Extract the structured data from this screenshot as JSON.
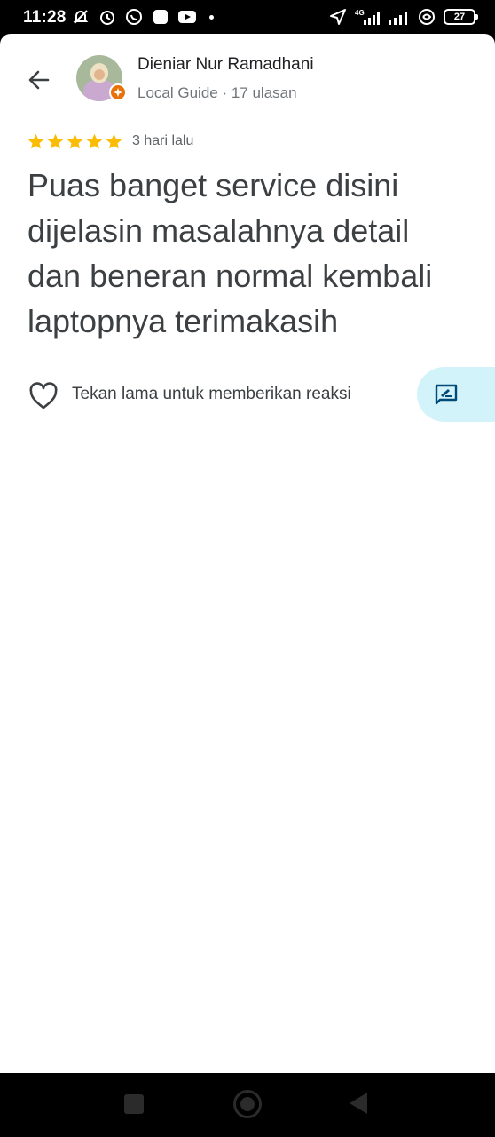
{
  "status_bar": {
    "time": "11:28",
    "left_icons": [
      "mute-icon",
      "alarm-icon",
      "whatsapp-icon",
      "app-icon",
      "youtube-icon",
      "dot-icon"
    ],
    "right_icons": [
      "location-icon",
      "signal-4g-icon",
      "signal-icon",
      "hotspot-icon",
      "battery-icon"
    ],
    "network_label": "4G",
    "battery_level": "27"
  },
  "review": {
    "reviewer_name": "Dieniar Nur Ramadhani",
    "reviewer_meta": "Local Guide · 17 ulasan",
    "rating": 5,
    "star_color": "#fbbc04",
    "date": "3 hari lalu",
    "text": "Puas banget service disini dijelasin masalahnya detail dan beneran normal kembali laptopnya terimakasih"
  },
  "reactions": {
    "hint": "Tekan lama untuk memberikan reaksi"
  },
  "colors": {
    "accent_badge": "#e8710a",
    "fab_background": "#d3f3fb",
    "fab_icon": "#004a77"
  }
}
